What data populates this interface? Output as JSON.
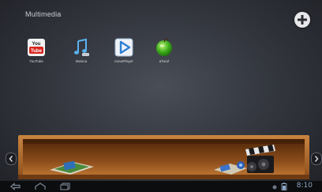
{
  "folder": {
    "title": "Multimedia"
  },
  "apps": [
    {
      "label": "YouTube",
      "icon": "youtube-icon"
    },
    {
      "label": "Musica",
      "icon": "music-note-icon"
    },
    {
      "label": "movePlayer",
      "icon": "play-icon"
    },
    {
      "label": "aTunZ",
      "icon": "green-apple-icon"
    }
  ],
  "youtube_logo": {
    "line1": "You",
    "line2": "Tube"
  },
  "status": {
    "time": "8:10"
  },
  "colors": {
    "shelf_wood": "#b26a2c",
    "shelf_inner": "#7a4216",
    "status_text": "#8fa7c4"
  },
  "icons": {
    "add": "plus-icon",
    "left": "chevron-left-icon",
    "right": "chevron-right-icon",
    "back": "back-icon",
    "home": "home-icon",
    "recent": "recent-apps-icon"
  }
}
